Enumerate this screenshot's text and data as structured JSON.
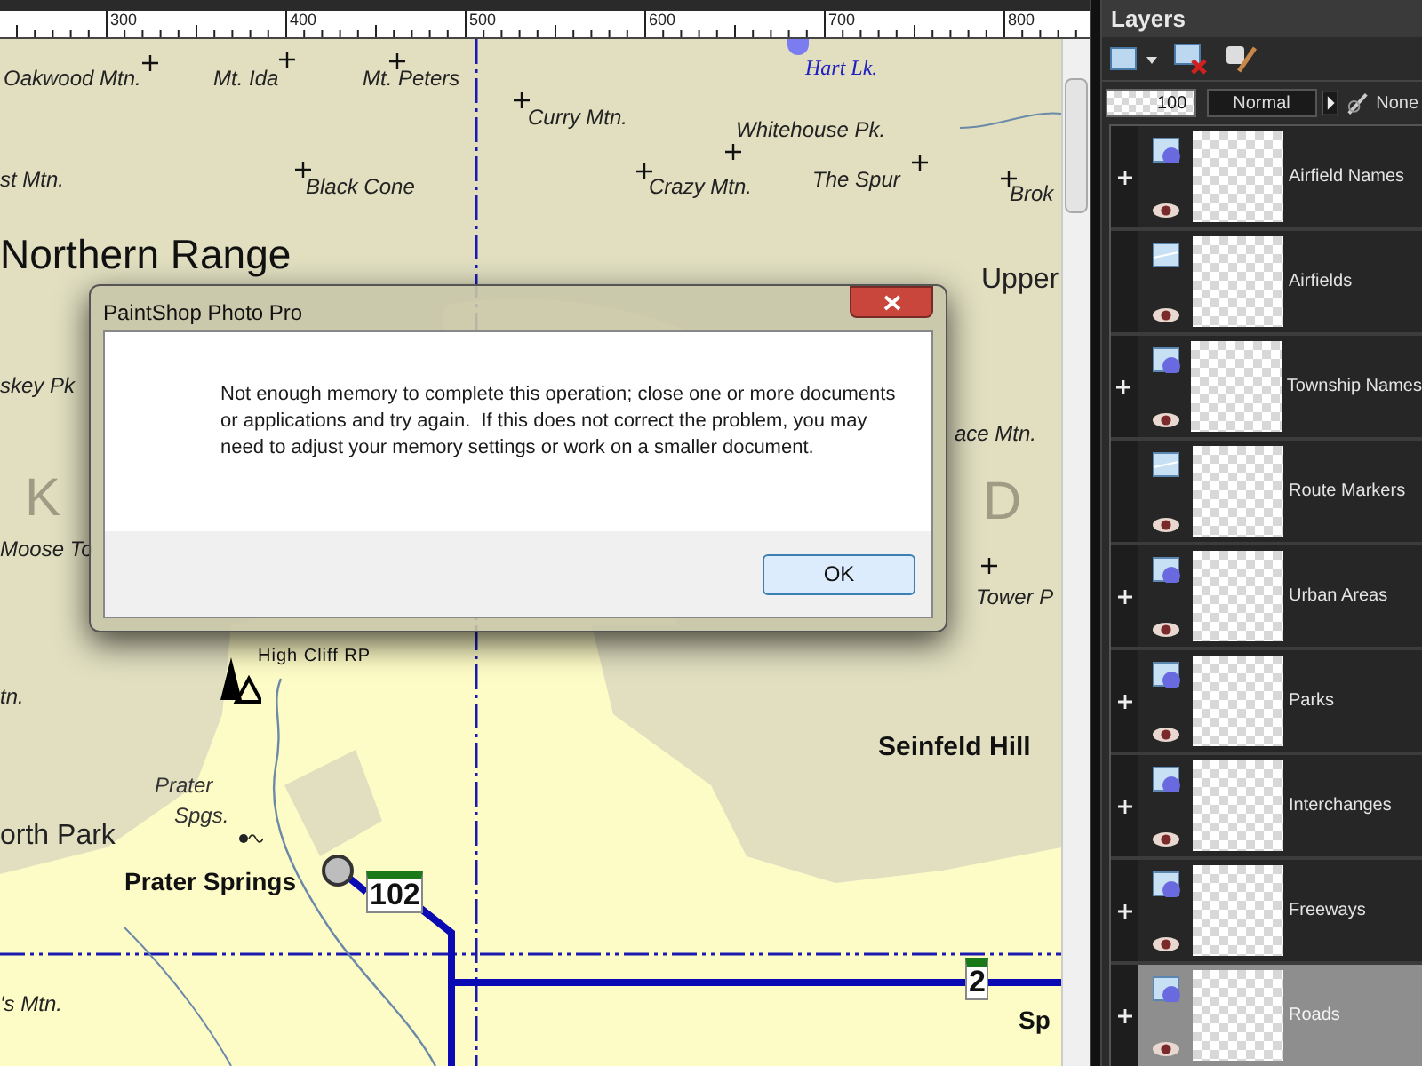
{
  "ruler": {
    "labels": [
      "300",
      "400",
      "500",
      "600",
      "700",
      "800"
    ]
  },
  "map": {
    "labels": [
      {
        "text": "Oakwood Mtn.",
        "kind": "peak"
      },
      {
        "text": "Mt. Ida",
        "kind": "peak"
      },
      {
        "text": "Mt. Peters",
        "kind": "peak"
      },
      {
        "text": "Hart Lk.",
        "kind": "lake"
      },
      {
        "text": "Curry Mtn.",
        "kind": "peak"
      },
      {
        "text": "Whitehouse Pk.",
        "kind": "peak"
      },
      {
        "text": "st Mtn.",
        "kind": "peak"
      },
      {
        "text": "Black Cone",
        "kind": "peak"
      },
      {
        "text": "Crazy Mtn.",
        "kind": "peak"
      },
      {
        "text": "The Spur",
        "kind": "peak"
      },
      {
        "text": "Brok",
        "kind": "peak"
      },
      {
        "text": "Northern Range",
        "kind": "range"
      },
      {
        "text": "Upper",
        "kind": "area"
      },
      {
        "text": "skey Pk",
        "kind": "peak"
      },
      {
        "text": "ace Mtn.",
        "kind": "peak"
      },
      {
        "text": "K",
        "kind": "faint"
      },
      {
        "text": "D",
        "kind": "faint"
      },
      {
        "text": "Moose To",
        "kind": "peak"
      },
      {
        "text": "Tower P",
        "kind": "peak"
      },
      {
        "text": "High Cliff RP",
        "kind": "park"
      },
      {
        "text": "tn.",
        "kind": "peak"
      },
      {
        "text": "Seinfeld Hill",
        "kind": "hill"
      },
      {
        "text": "Prater",
        "kind": "spring"
      },
      {
        "text": "Spgs.",
        "kind": "spring"
      },
      {
        "text": "orth Park",
        "kind": "area"
      },
      {
        "text": "Prater Springs",
        "kind": "town"
      },
      {
        "text": "'s Mtn.",
        "kind": "peak"
      },
      {
        "text": "Sp",
        "kind": "town"
      }
    ],
    "shields": [
      "102",
      "2"
    ]
  },
  "dialog": {
    "title": "PaintShop Photo Pro",
    "message": "Not enough memory to complete this operation; close one or more documents or applications and try again.  If this does not correct the problem, you may need to adjust your memory settings or work on a smaller document.",
    "button": "OK"
  },
  "layers_panel": {
    "title": "Layers",
    "opacity": "100",
    "blend_mode": "Normal",
    "link_mode": "None",
    "layers": [
      {
        "name": "Airfield Names",
        "kind": "vector",
        "expandable": true,
        "selected": false
      },
      {
        "name": "Airfields",
        "kind": "raster",
        "expandable": false,
        "selected": false
      },
      {
        "name": "Township Names",
        "kind": "vector",
        "expandable": true,
        "selected": false
      },
      {
        "name": "Route Markers",
        "kind": "raster",
        "expandable": false,
        "selected": false
      },
      {
        "name": "Urban Areas",
        "kind": "vector",
        "expandable": true,
        "selected": false
      },
      {
        "name": "Parks",
        "kind": "vector",
        "expandable": true,
        "selected": false
      },
      {
        "name": "Interchanges",
        "kind": "vector",
        "expandable": true,
        "selected": false
      },
      {
        "name": "Freeways",
        "kind": "vector",
        "expandable": true,
        "selected": false
      },
      {
        "name": "Roads",
        "kind": "vector",
        "expandable": true,
        "selected": true
      }
    ]
  }
}
